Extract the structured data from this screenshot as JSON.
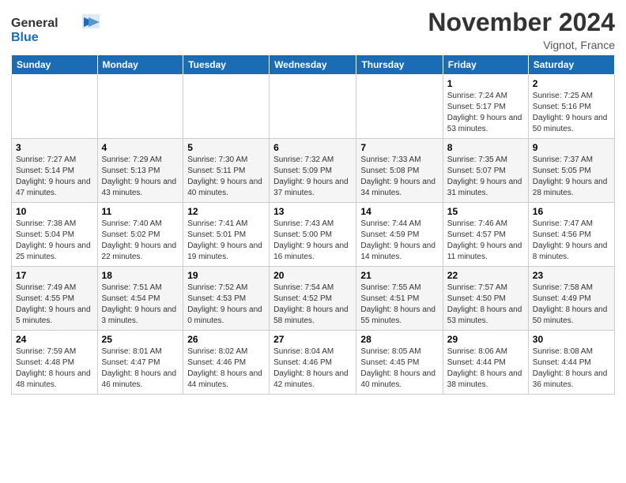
{
  "logo": {
    "line1": "General",
    "line2": "Blue"
  },
  "title": "November 2024",
  "location": "Vignot, France",
  "weekdays": [
    "Sunday",
    "Monday",
    "Tuesday",
    "Wednesday",
    "Thursday",
    "Friday",
    "Saturday"
  ],
  "weeks": [
    [
      {
        "day": "",
        "info": ""
      },
      {
        "day": "",
        "info": ""
      },
      {
        "day": "",
        "info": ""
      },
      {
        "day": "",
        "info": ""
      },
      {
        "day": "",
        "info": ""
      },
      {
        "day": "1",
        "info": "Sunrise: 7:24 AM\nSunset: 5:17 PM\nDaylight: 9 hours and 53 minutes."
      },
      {
        "day": "2",
        "info": "Sunrise: 7:25 AM\nSunset: 5:16 PM\nDaylight: 9 hours and 50 minutes."
      }
    ],
    [
      {
        "day": "3",
        "info": "Sunrise: 7:27 AM\nSunset: 5:14 PM\nDaylight: 9 hours and 47 minutes."
      },
      {
        "day": "4",
        "info": "Sunrise: 7:29 AM\nSunset: 5:13 PM\nDaylight: 9 hours and 43 minutes."
      },
      {
        "day": "5",
        "info": "Sunrise: 7:30 AM\nSunset: 5:11 PM\nDaylight: 9 hours and 40 minutes."
      },
      {
        "day": "6",
        "info": "Sunrise: 7:32 AM\nSunset: 5:09 PM\nDaylight: 9 hours and 37 minutes."
      },
      {
        "day": "7",
        "info": "Sunrise: 7:33 AM\nSunset: 5:08 PM\nDaylight: 9 hours and 34 minutes."
      },
      {
        "day": "8",
        "info": "Sunrise: 7:35 AM\nSunset: 5:07 PM\nDaylight: 9 hours and 31 minutes."
      },
      {
        "day": "9",
        "info": "Sunrise: 7:37 AM\nSunset: 5:05 PM\nDaylight: 9 hours and 28 minutes."
      }
    ],
    [
      {
        "day": "10",
        "info": "Sunrise: 7:38 AM\nSunset: 5:04 PM\nDaylight: 9 hours and 25 minutes."
      },
      {
        "day": "11",
        "info": "Sunrise: 7:40 AM\nSunset: 5:02 PM\nDaylight: 9 hours and 22 minutes."
      },
      {
        "day": "12",
        "info": "Sunrise: 7:41 AM\nSunset: 5:01 PM\nDaylight: 9 hours and 19 minutes."
      },
      {
        "day": "13",
        "info": "Sunrise: 7:43 AM\nSunset: 5:00 PM\nDaylight: 9 hours and 16 minutes."
      },
      {
        "day": "14",
        "info": "Sunrise: 7:44 AM\nSunset: 4:59 PM\nDaylight: 9 hours and 14 minutes."
      },
      {
        "day": "15",
        "info": "Sunrise: 7:46 AM\nSunset: 4:57 PM\nDaylight: 9 hours and 11 minutes."
      },
      {
        "day": "16",
        "info": "Sunrise: 7:47 AM\nSunset: 4:56 PM\nDaylight: 9 hours and 8 minutes."
      }
    ],
    [
      {
        "day": "17",
        "info": "Sunrise: 7:49 AM\nSunset: 4:55 PM\nDaylight: 9 hours and 5 minutes."
      },
      {
        "day": "18",
        "info": "Sunrise: 7:51 AM\nSunset: 4:54 PM\nDaylight: 9 hours and 3 minutes."
      },
      {
        "day": "19",
        "info": "Sunrise: 7:52 AM\nSunset: 4:53 PM\nDaylight: 9 hours and 0 minutes."
      },
      {
        "day": "20",
        "info": "Sunrise: 7:54 AM\nSunset: 4:52 PM\nDaylight: 8 hours and 58 minutes."
      },
      {
        "day": "21",
        "info": "Sunrise: 7:55 AM\nSunset: 4:51 PM\nDaylight: 8 hours and 55 minutes."
      },
      {
        "day": "22",
        "info": "Sunrise: 7:57 AM\nSunset: 4:50 PM\nDaylight: 8 hours and 53 minutes."
      },
      {
        "day": "23",
        "info": "Sunrise: 7:58 AM\nSunset: 4:49 PM\nDaylight: 8 hours and 50 minutes."
      }
    ],
    [
      {
        "day": "24",
        "info": "Sunrise: 7:59 AM\nSunset: 4:48 PM\nDaylight: 8 hours and 48 minutes."
      },
      {
        "day": "25",
        "info": "Sunrise: 8:01 AM\nSunset: 4:47 PM\nDaylight: 8 hours and 46 minutes."
      },
      {
        "day": "26",
        "info": "Sunrise: 8:02 AM\nSunset: 4:46 PM\nDaylight: 8 hours and 44 minutes."
      },
      {
        "day": "27",
        "info": "Sunrise: 8:04 AM\nSunset: 4:46 PM\nDaylight: 8 hours and 42 minutes."
      },
      {
        "day": "28",
        "info": "Sunrise: 8:05 AM\nSunset: 4:45 PM\nDaylight: 8 hours and 40 minutes."
      },
      {
        "day": "29",
        "info": "Sunrise: 8:06 AM\nSunset: 4:44 PM\nDaylight: 8 hours and 38 minutes."
      },
      {
        "day": "30",
        "info": "Sunrise: 8:08 AM\nSunset: 4:44 PM\nDaylight: 8 hours and 36 minutes."
      }
    ]
  ]
}
